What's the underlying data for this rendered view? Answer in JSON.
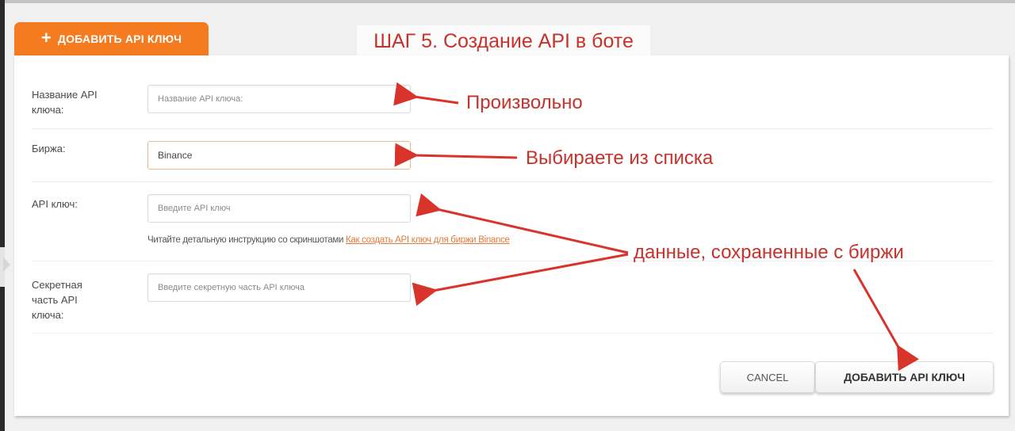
{
  "tab": {
    "icon": "plus-icon",
    "plus": "+",
    "label": "ДОБАВИТЬ API КЛЮЧ"
  },
  "banner": "ШАГ 5. Создание API в боте",
  "form": {
    "name": {
      "label": "Название API ключа:",
      "placeholder": "Название API ключа:",
      "value": ""
    },
    "exchange": {
      "label": "Биржа:",
      "selected": "Binance"
    },
    "api_key": {
      "label": "API ключ:",
      "placeholder": "Введите API ключ",
      "value": "",
      "hint_text": "Читайте детальную инструкцию со скриншотами ",
      "hint_link": "Как создать API ключ для биржи Binance"
    },
    "secret": {
      "label": "Секретная часть API ключа:",
      "placeholder": "Введите секретную часть API ключа",
      "value": ""
    }
  },
  "buttons": {
    "cancel": "CANCEL",
    "submit": "ДОБАВИТЬ API КЛЮЧ"
  },
  "annotations": {
    "name": "Произвольно",
    "exchange": "Выбираете из списка",
    "keys": "данные, сохраненные с биржи"
  },
  "colors": {
    "accent": "#f47b20",
    "annotation": "#c6322c",
    "link": "#e07a3c"
  }
}
